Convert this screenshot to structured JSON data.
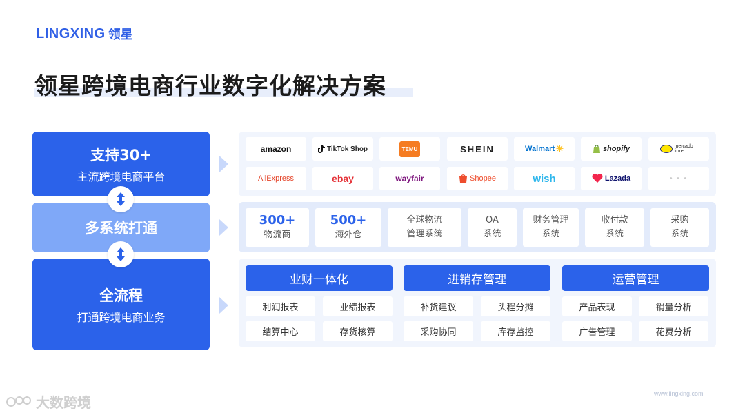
{
  "logo": {
    "latin": "LINGXING",
    "cjk": "领星"
  },
  "title": "领星跨境电商行业数字化解决方案",
  "left": {
    "box1": {
      "main": "支持30+",
      "sub": "主流跨境电商平台"
    },
    "box2": {
      "main": "多系统打通"
    },
    "box3": {
      "main": "全流程",
      "sub": "打通跨境电商业务"
    }
  },
  "platforms": {
    "row1": [
      "amazon",
      "TikTok Shop",
      "TEMU",
      "SHEIN",
      "Walmart",
      "shopify",
      "mercado libre"
    ],
    "row2": [
      "AliExpress",
      "ebay",
      "wayfair",
      "Shopee",
      "wish",
      "Lazada",
      "• • •"
    ],
    "colors": {
      "amazon": "#111111",
      "temu": "#f57c22",
      "aliexpress": "#e4452a",
      "ebay": "#e53238",
      "wayfair": "#7f187f",
      "shopee": "#ee4d2d",
      "wish": "#2fb7ec",
      "lazada": "#0f136d",
      "shopify": "#2e2e2e",
      "walmart": "#0071ce",
      "mercado": "#333333"
    }
  },
  "systems": [
    {
      "big": "300+",
      "small": "物流商"
    },
    {
      "big": "500+",
      "small": "海外仓"
    },
    {
      "line1": "全球物流",
      "line2": "管理系统"
    },
    {
      "line1": "OA",
      "line2": "系统"
    },
    {
      "line1": "财务管理",
      "line2": "系统"
    },
    {
      "line1": "收付款",
      "line2": "系统"
    },
    {
      "line1": "采购",
      "line2": "系统"
    }
  ],
  "categories": [
    {
      "title": "业财一体化",
      "items": [
        "利润报表",
        "业绩报表",
        "结算中心",
        "存货核算"
      ]
    },
    {
      "title": "进销存管理",
      "items": [
        "补货建议",
        "头程分摊",
        "采购协同",
        "库存监控"
      ]
    },
    {
      "title": "运营管理",
      "items": [
        "产品表现",
        "销量分析",
        "广告管理",
        "花费分析"
      ]
    }
  ],
  "website": "www.lingxing.com",
  "watermark": "大数跨境",
  "accent": "#2b62ea",
  "accent_light": "#7fa8f8"
}
